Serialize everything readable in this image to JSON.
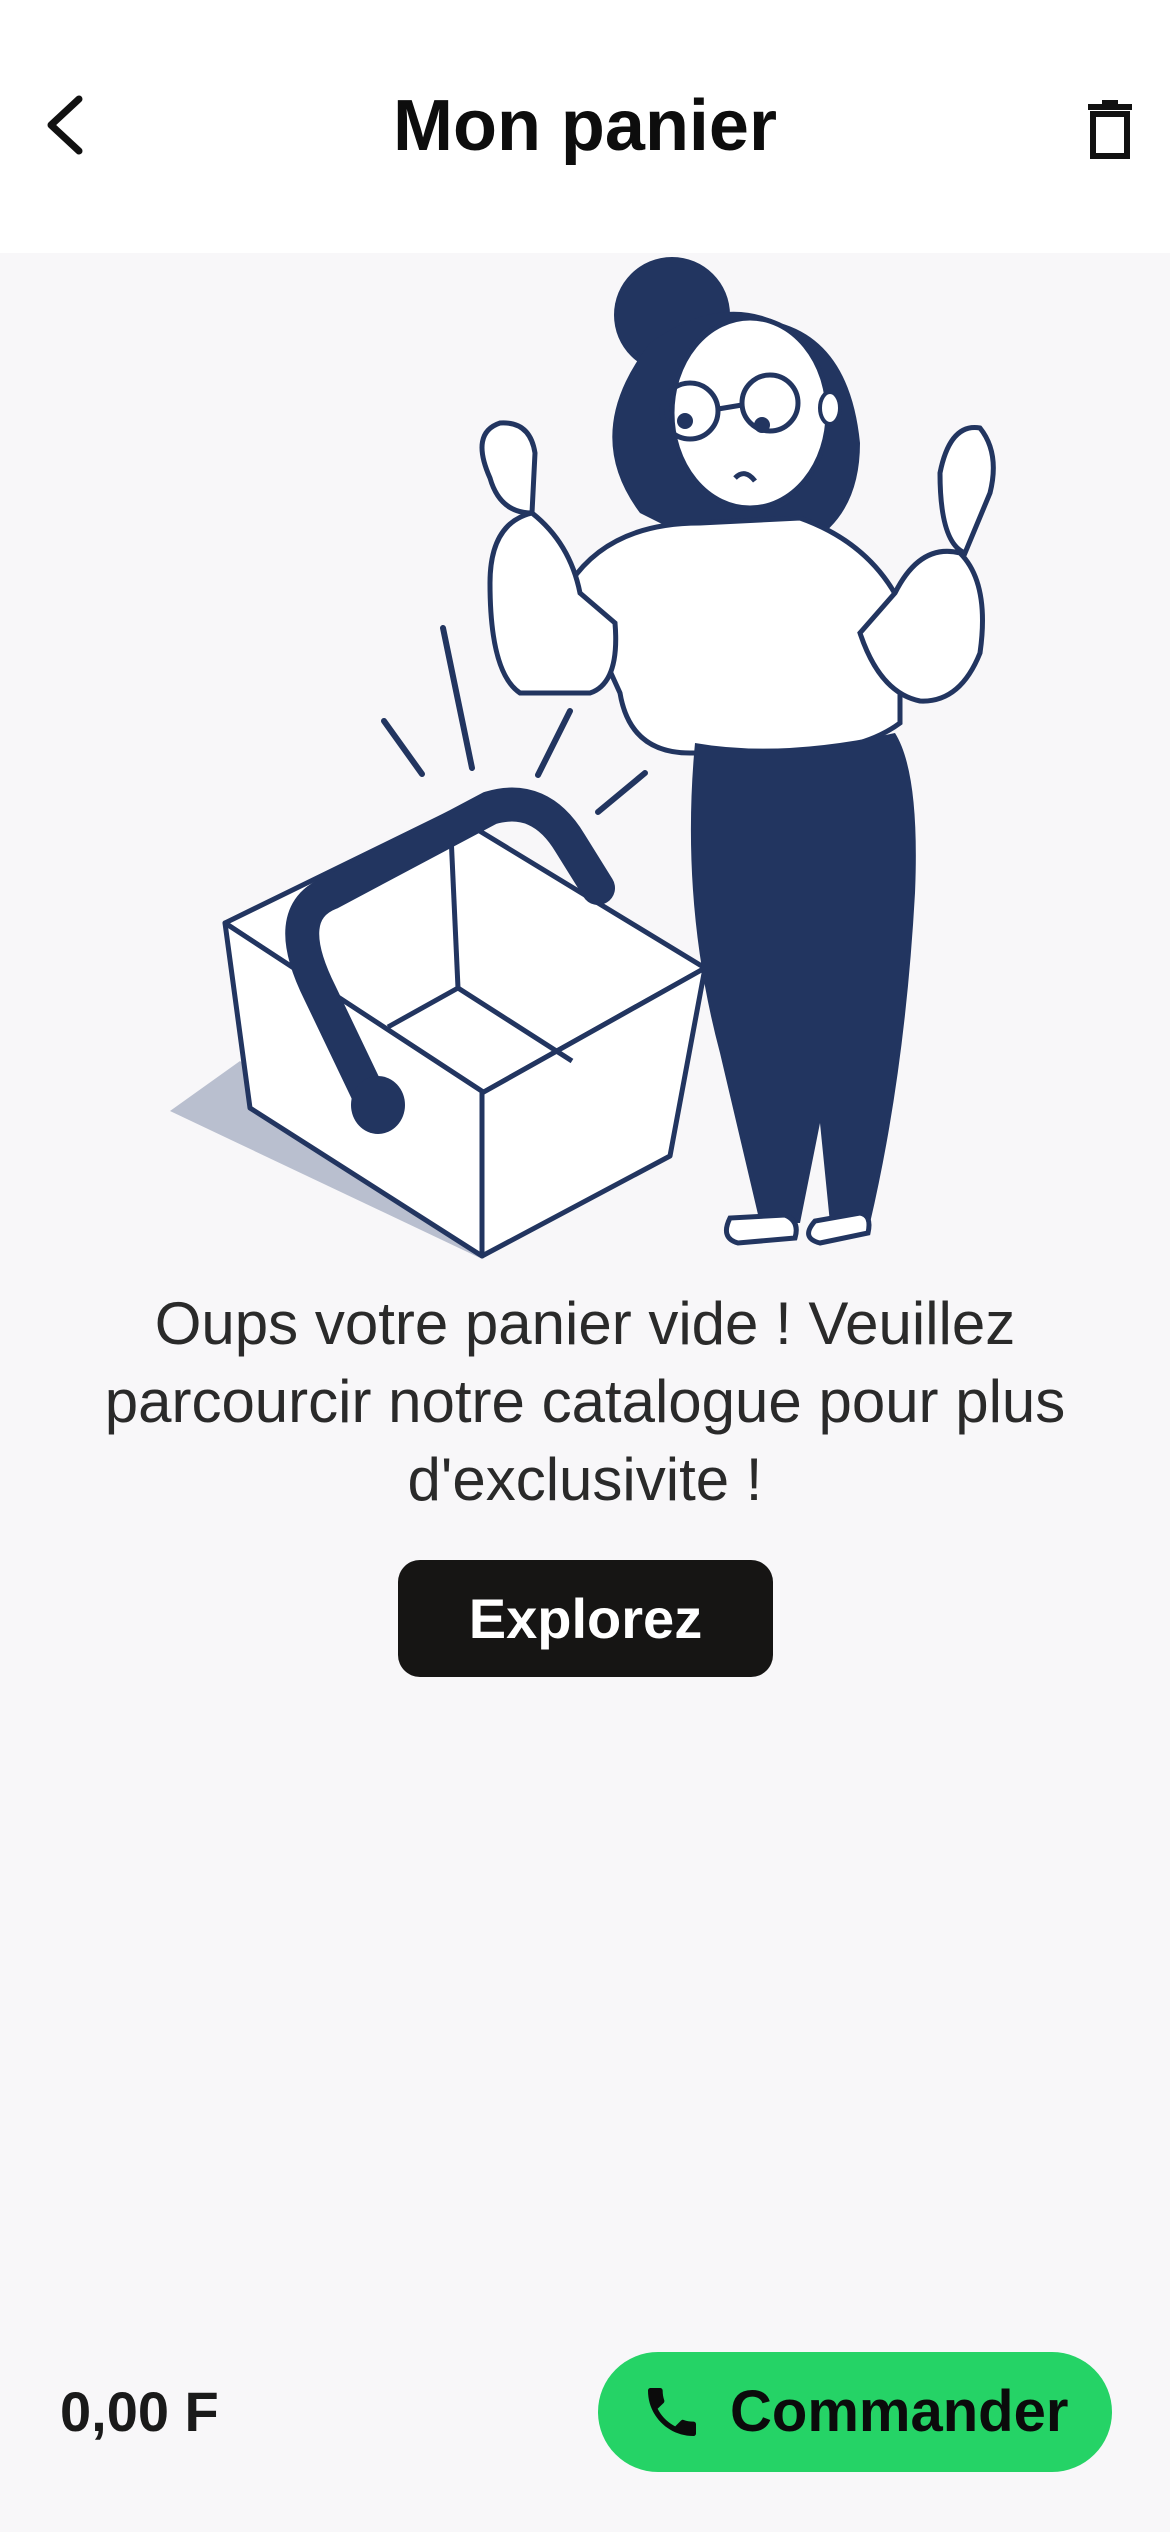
{
  "header": {
    "title": "Mon panier",
    "back_icon": "chevron-left-icon",
    "trash_icon": "trash-icon"
  },
  "empty_state": {
    "message": "Oups votre panier vide ! Veuillez parcourcir notre catalogue pour plus d'exclusivite !",
    "explore_label": "Explorez"
  },
  "footer": {
    "total": "0,00 F",
    "order_label": "Commander",
    "order_icon": "phone-icon"
  },
  "colors": {
    "header_bg": "#ffffff",
    "page_bg": "#f8f7f9",
    "illustration_navy": "#223560",
    "explore_bg": "#161514",
    "order_bg": "#25d366"
  }
}
